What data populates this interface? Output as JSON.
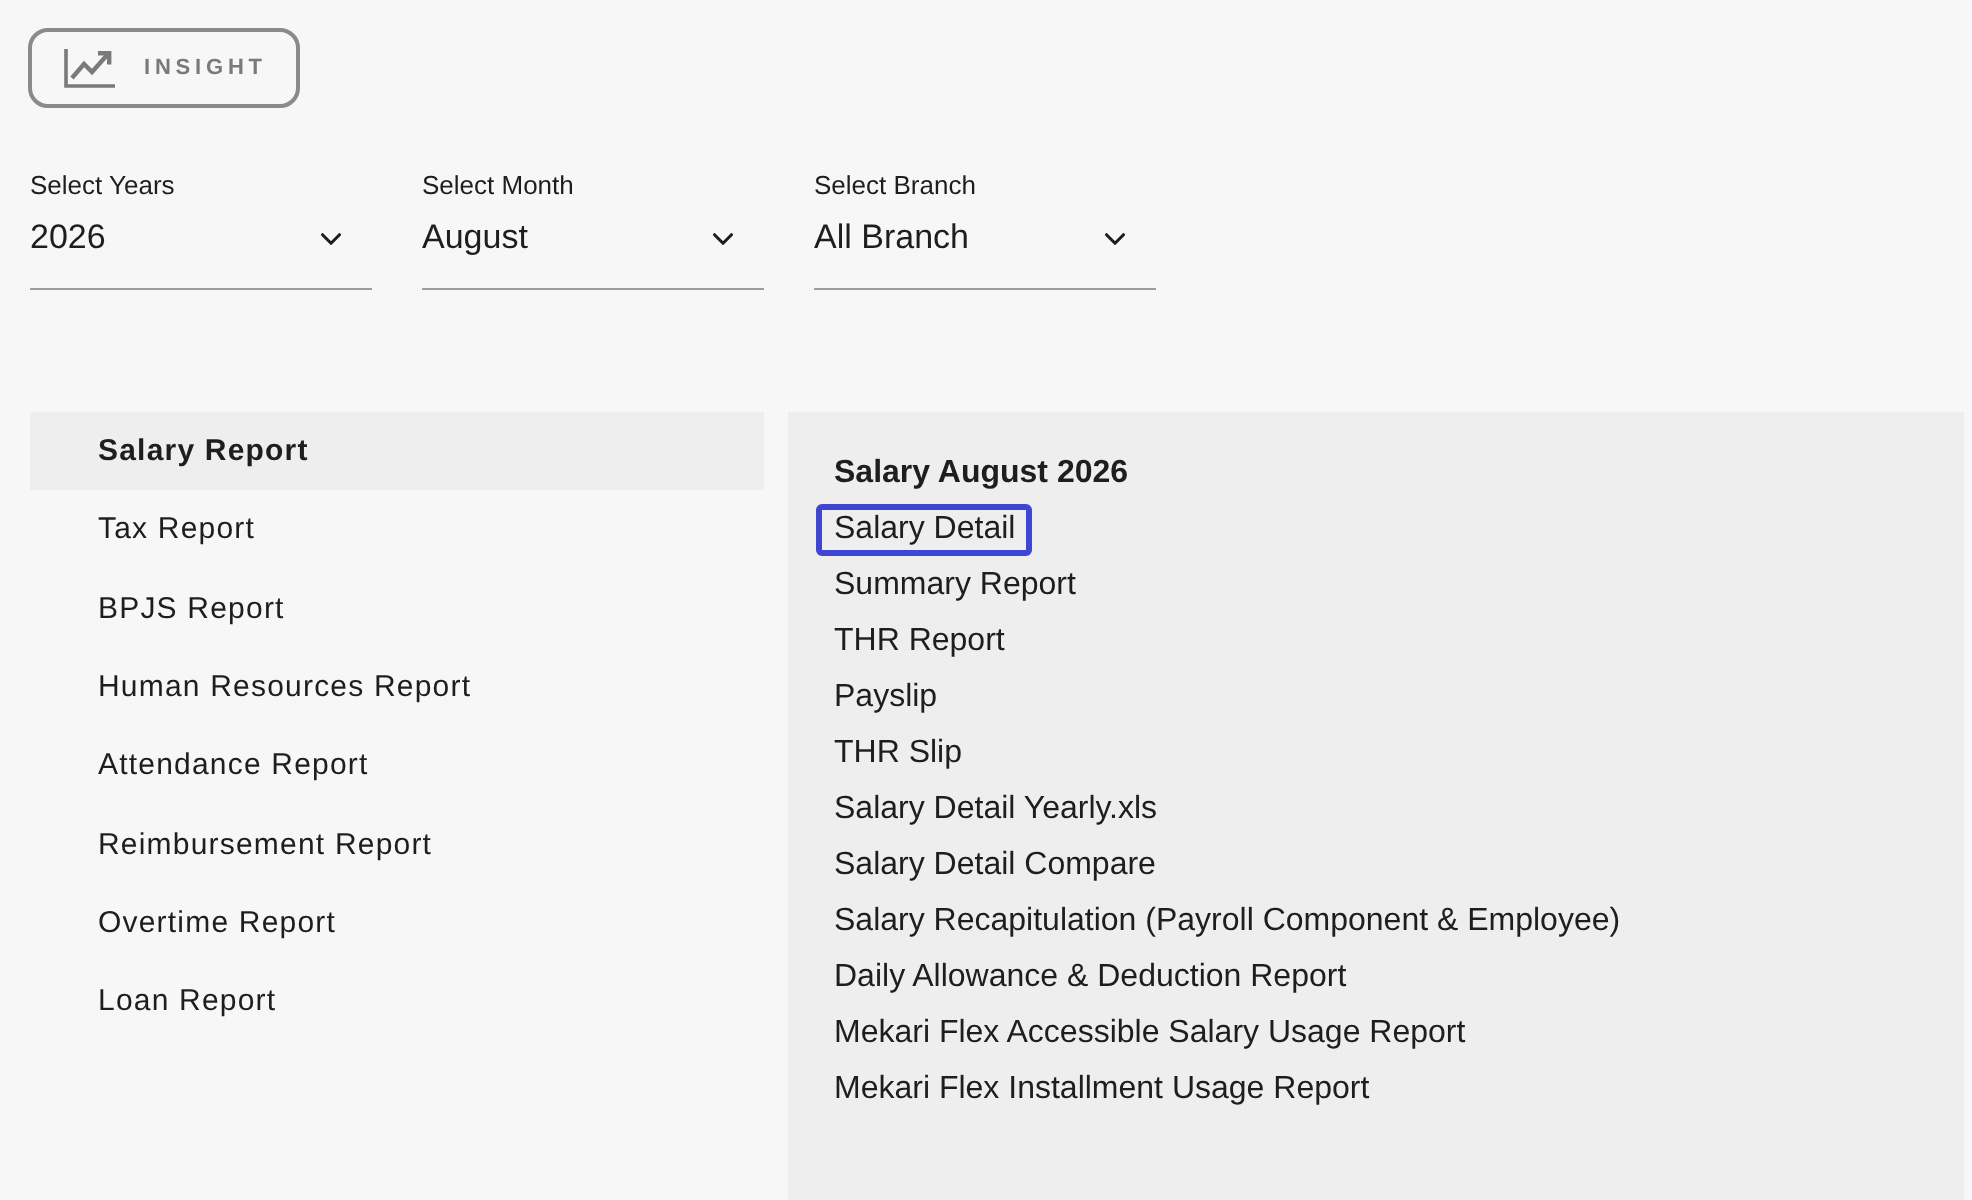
{
  "insight_button": {
    "label": "INSIGHT"
  },
  "filters": [
    {
      "label": "Select Years",
      "value": "2026"
    },
    {
      "label": "Select Month",
      "value": "August"
    },
    {
      "label": "Select Branch",
      "value": "All Branch"
    }
  ],
  "sidebar": {
    "items": [
      {
        "label": "Salary Report",
        "selected": true
      },
      {
        "label": "Tax Report",
        "selected": false
      },
      {
        "label": "BPJS Report",
        "selected": false
      },
      {
        "label": "Human Resources Report",
        "selected": false
      },
      {
        "label": "Attendance Report",
        "selected": false
      },
      {
        "label": "Reimbursement Report",
        "selected": false
      },
      {
        "label": "Overtime Report",
        "selected": false
      },
      {
        "label": "Loan Report",
        "selected": false
      }
    ]
  },
  "panel": {
    "title": "Salary August 2026",
    "links": [
      {
        "label": "Salary Detail",
        "selected": true
      },
      {
        "label": "Summary Report",
        "selected": false
      },
      {
        "label": "THR Report",
        "selected": false
      },
      {
        "label": "Payslip",
        "selected": false
      },
      {
        "label": "THR Slip",
        "selected": false
      },
      {
        "label": "Salary Detail Yearly.xls",
        "selected": false
      },
      {
        "label": "Salary Detail Compare",
        "selected": false
      },
      {
        "label": "Salary Recapitulation (Payroll Component & Employee)",
        "selected": false
      },
      {
        "label": "Daily Allowance & Deduction Report",
        "selected": false
      },
      {
        "label": "Mekari Flex Accessible Salary Usage Report",
        "selected": false
      },
      {
        "label": "Mekari Flex Installment Usage Report",
        "selected": false
      }
    ]
  }
}
